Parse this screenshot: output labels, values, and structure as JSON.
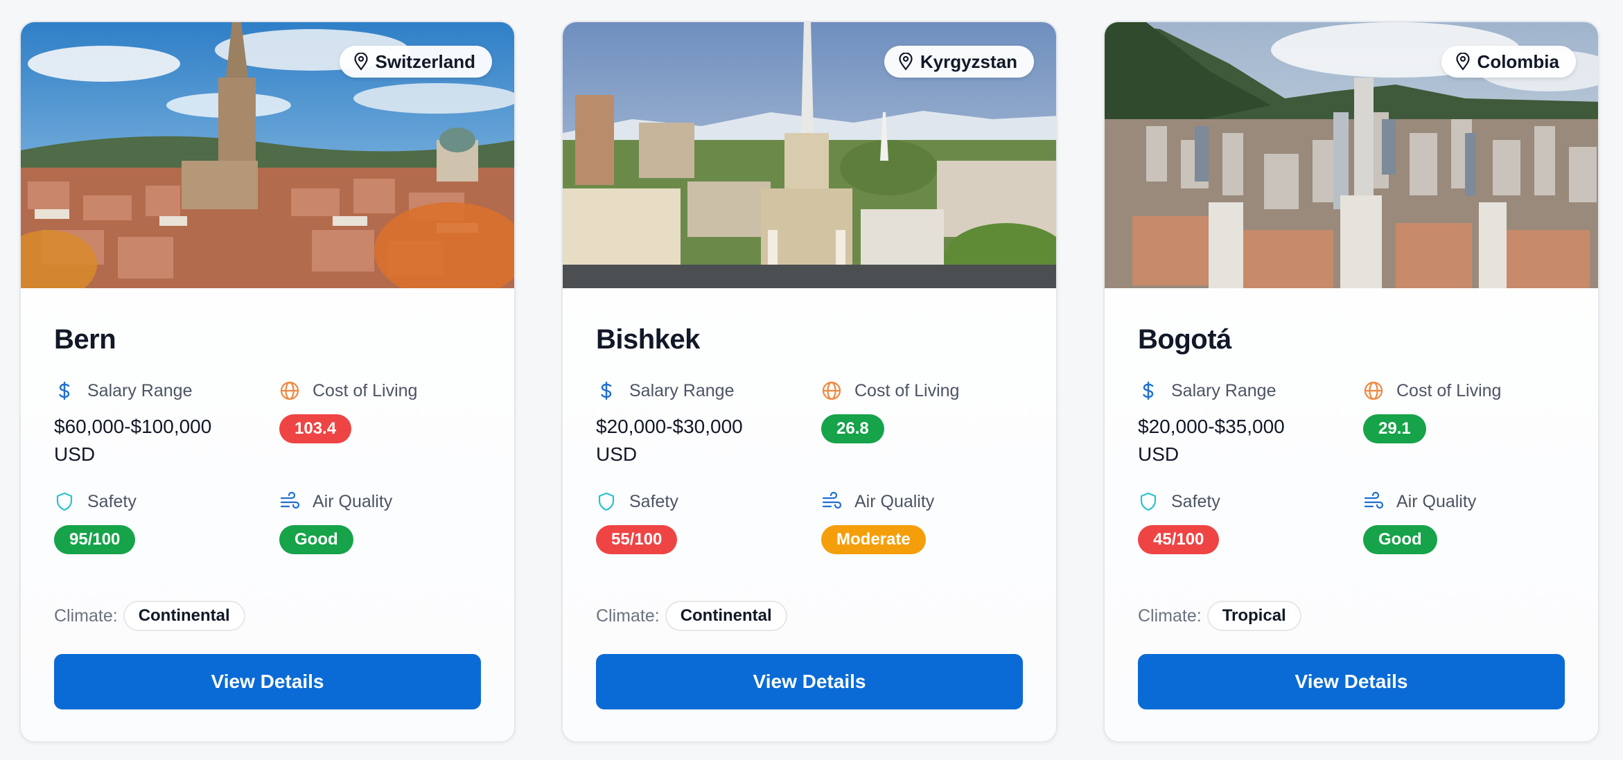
{
  "labels": {
    "salary": "Salary Range",
    "cost": "Cost of Living",
    "safety": "Safety",
    "air": "Air Quality",
    "climate": "Climate:",
    "button": "View Details"
  },
  "cities": [
    {
      "name": "Bern",
      "country": "Switzerland",
      "salary": "$60,000-$100,000 USD",
      "cost_of_living": "103.4",
      "cost_color": "red",
      "safety": "95/100",
      "safety_color": "green",
      "air_quality": "Good",
      "air_color": "green",
      "climate": "Continental"
    },
    {
      "name": "Bishkek",
      "country": "Kyrgyzstan",
      "salary": "$20,000-$30,000 USD",
      "cost_of_living": "26.8",
      "cost_color": "green",
      "safety": "55/100",
      "safety_color": "red",
      "air_quality": "Moderate",
      "air_color": "amber",
      "climate": "Continental"
    },
    {
      "name": "Bogotá",
      "country": "Colombia",
      "salary": "$20,000-$35,000 USD",
      "cost_of_living": "29.1",
      "cost_color": "green",
      "safety": "45/100",
      "safety_color": "red",
      "air_quality": "Good",
      "air_color": "green",
      "climate": "Tropical"
    }
  ],
  "colors": {
    "primary_button": "#0a6bd6",
    "badge_red": "#ef4444",
    "badge_green": "#16a34a",
    "badge_amber": "#f59e0b"
  }
}
